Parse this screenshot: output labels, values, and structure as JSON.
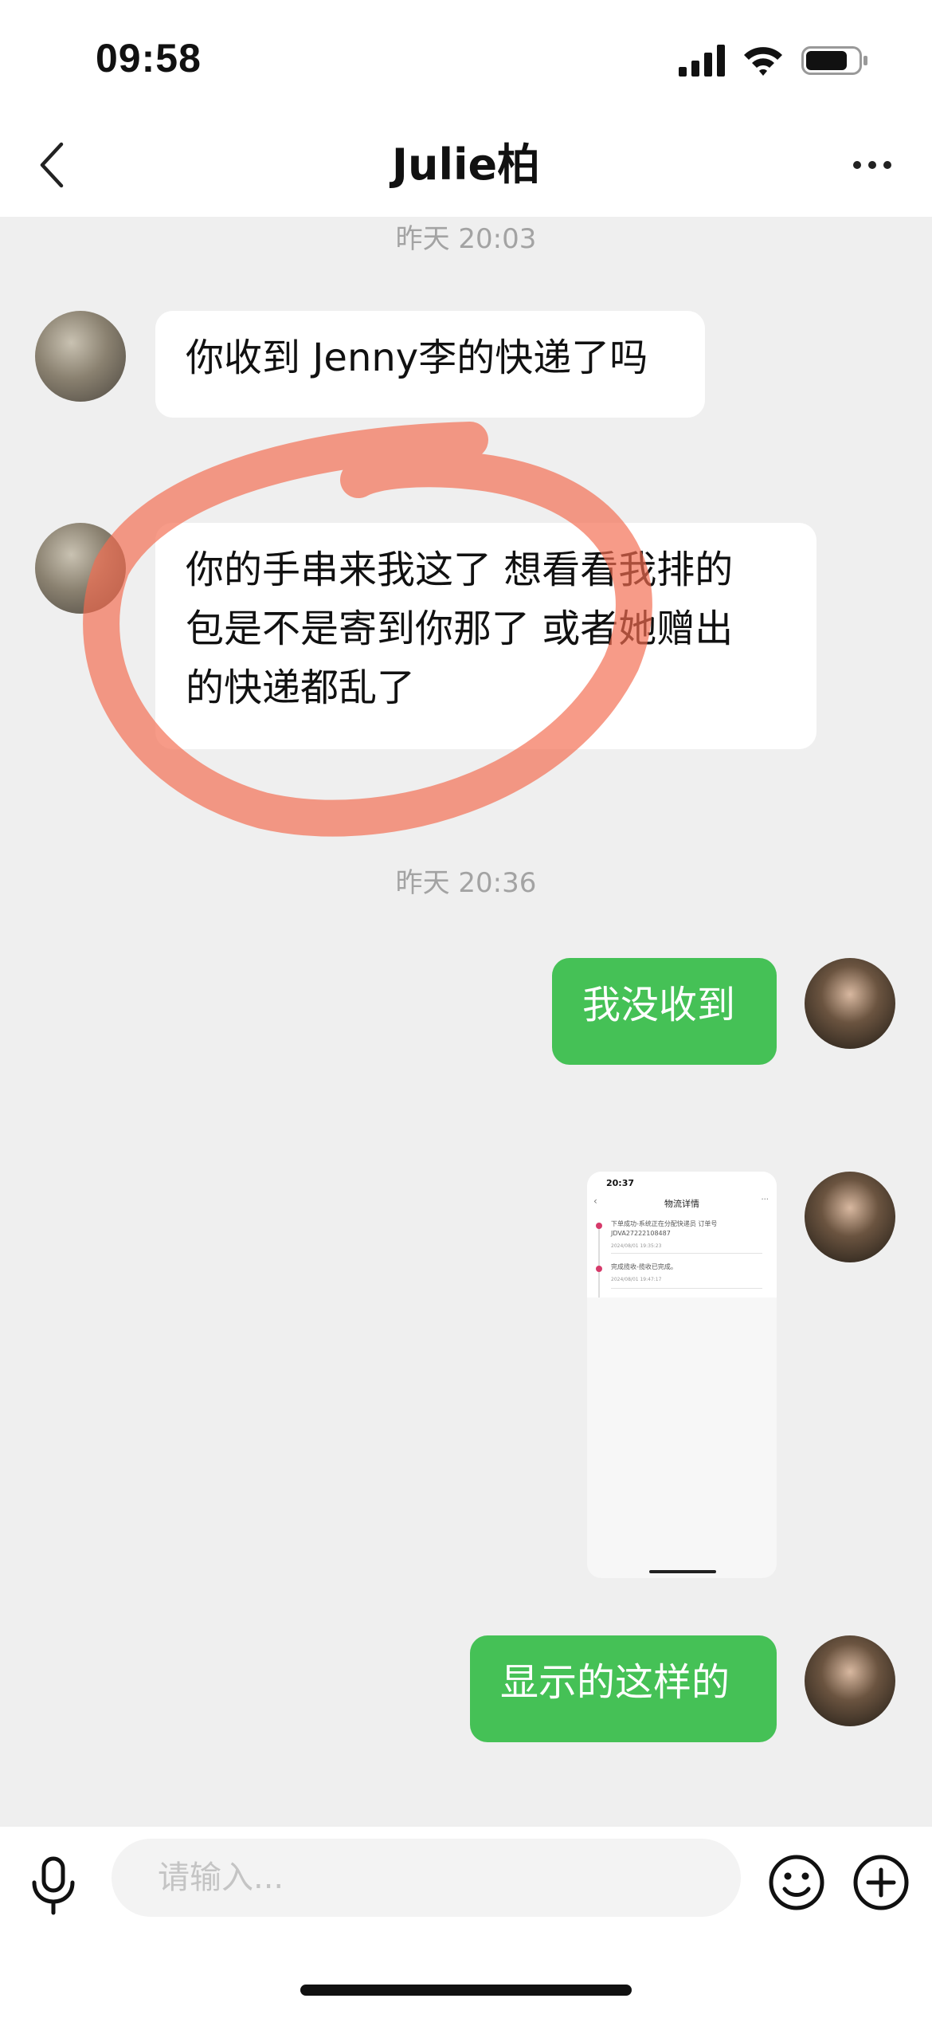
{
  "status_bar": {
    "time": "09:58",
    "battery_level": 0.8
  },
  "nav": {
    "title": "Julie柏"
  },
  "messages": [
    {
      "kind": "timestamp",
      "text": "昨天 20:03"
    },
    {
      "kind": "incoming",
      "text": "你收到 Jenny李的快递了吗"
    },
    {
      "kind": "incoming",
      "lines": [
        "你的手串来我这了  想看看我排的",
        "包是不是寄到你那了  或者她赠出",
        "的快递都乱了"
      ]
    },
    {
      "kind": "timestamp",
      "text": "昨天 20:36"
    },
    {
      "kind": "outgoing",
      "text": "我没收到"
    },
    {
      "kind": "outgoing-image",
      "screenshot": {
        "time": "20:37",
        "title": "物流详情",
        "events": [
          {
            "text": "下单成功-系统正在分配快递员 订单号JDVA27222108487",
            "date": "2024/08/01 19:35:23"
          },
          {
            "text": "完成揽收-揽收已完成。",
            "date": "2024/08/01 19:47:17"
          }
        ]
      }
    },
    {
      "kind": "outgoing",
      "text": "显示的这样的"
    }
  ],
  "input": {
    "placeholder": "请输入..."
  },
  "colors": {
    "outgoing_bubble": "#45c156",
    "annotation": "#f36b4f",
    "background": "#efefef"
  }
}
